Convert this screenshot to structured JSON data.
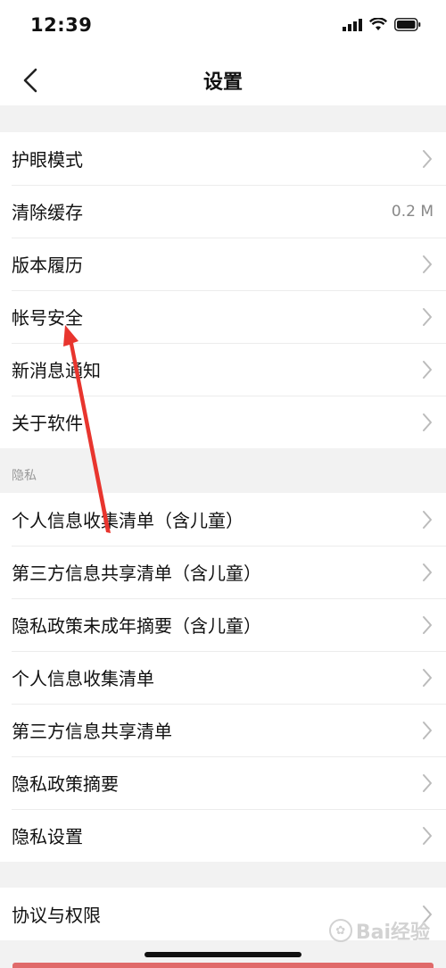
{
  "status_bar": {
    "time": "12:39",
    "icons": [
      "signal-icon",
      "wifi-icon",
      "battery-icon"
    ]
  },
  "nav": {
    "title": "设置",
    "back_icon": "chevron-left-icon"
  },
  "group1": {
    "items": [
      {
        "label": "护眼模式",
        "value": ""
      },
      {
        "label": "清除缓存",
        "value": "0.2 M"
      },
      {
        "label": "版本履历",
        "value": ""
      },
      {
        "label": "帐号安全",
        "value": ""
      },
      {
        "label": "新消息通知",
        "value": ""
      },
      {
        "label": "关于软件",
        "value": ""
      }
    ]
  },
  "privacy": {
    "header": "隐私",
    "items": [
      {
        "label": "个人信息收集清单（含儿童）"
      },
      {
        "label": "第三方信息共享清单（含儿童）"
      },
      {
        "label": "隐私政策未成年摘要（含儿童）"
      },
      {
        "label": "个人信息收集清单"
      },
      {
        "label": "第三方信息共享清单"
      },
      {
        "label": "隐私政策摘要"
      },
      {
        "label": "隐私设置"
      }
    ]
  },
  "group3": {
    "items": [
      {
        "label": "协议与权限"
      }
    ]
  },
  "watermark": {
    "text": "Bai经验"
  },
  "colors": {
    "annotation_arrow": "#e8352e",
    "separator": "#ececec",
    "page_bg": "#f2f2f2"
  }
}
